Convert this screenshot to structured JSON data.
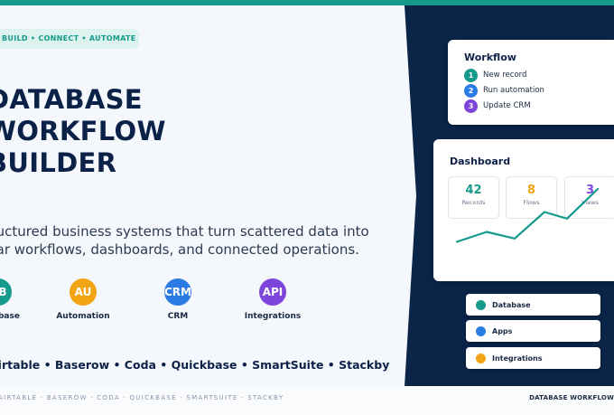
{
  "tagline": "BUILD • CONNECT • AUTOMATE",
  "title_lines": [
    "DATABASE",
    "WORKFLOW",
    "BUILDER"
  ],
  "description_lines": [
    "Structured business systems that turn scattered data into",
    "clear workflows, dashboards, and connected operations."
  ],
  "features": [
    {
      "badge": "DB",
      "label": "Database",
      "color": "#159a8b"
    },
    {
      "badge": "AU",
      "label": "Automation",
      "color": "#f2a413"
    },
    {
      "badge": "CRM",
      "label": "CRM",
      "color": "#2b7be4"
    },
    {
      "badge": "API",
      "label": "Integrations",
      "color": "#7d45d9"
    }
  ],
  "platforms": "Airtable • Baserow • Coda • Quickbase • SmartSuite • Stackby",
  "footer_left": "AIRTABLE · BASEROW · CODA · QUICKBASE · SMARTSUITE · STACKBY",
  "footer_right": "DATABASE WORKFLOW",
  "workflow": {
    "title": "Workflow",
    "steps": [
      {
        "num": "1",
        "label": "New record",
        "color": "#159a8b"
      },
      {
        "num": "2",
        "label": "Run automation",
        "color": "#2b7be4"
      },
      {
        "num": "3",
        "label": "Update CRM",
        "color": "#7d45d9"
      }
    ]
  },
  "dashboard": {
    "title": "Dashboard",
    "stats": [
      {
        "value": "42",
        "label": "Records",
        "color": "#159a8b"
      },
      {
        "value": "8",
        "label": "Flows",
        "color": "#f2a413"
      },
      {
        "value": "3",
        "label": "Views",
        "color": "#7d45d9"
      }
    ],
    "trend_values": [
      20,
      35,
      25,
      65,
      55,
      100
    ],
    "line_color": "#159a8b"
  },
  "legend": [
    {
      "label": "Database",
      "color": "#159a8b"
    },
    {
      "label": "Apps",
      "color": "#2b7be4"
    },
    {
      "label": "Integrations",
      "color": "#f2a413"
    }
  ],
  "colors": {
    "accent": "#159a8b",
    "navy": "#0b2549"
  }
}
